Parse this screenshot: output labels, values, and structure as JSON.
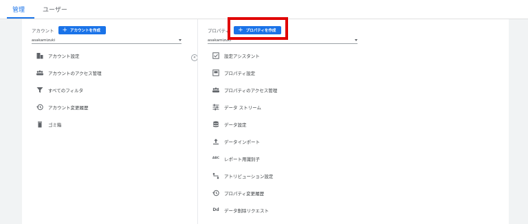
{
  "tabs": [
    {
      "label": "管理",
      "active": true
    },
    {
      "label": "ユーザー",
      "active": false
    }
  ],
  "account": {
    "label": "アカウント",
    "create_button": "アカウントを作成",
    "selected": "asakamizuki",
    "items": [
      {
        "label": "アカウント設定",
        "icon": "building-icon"
      },
      {
        "label": "アカウントのアクセス管理",
        "icon": "people-icon"
      },
      {
        "label": "すべてのフィルタ",
        "icon": "filter-icon"
      },
      {
        "label": "アカウント変更履歴",
        "icon": "history-icon"
      },
      {
        "label": "ゴミ箱",
        "icon": "trash-icon"
      }
    ]
  },
  "property": {
    "label": "プロパティ",
    "create_button": "プロパティを作成",
    "selected": "asakamizuki",
    "items": [
      {
        "label": "設定アシスタント",
        "icon": "checkbox-icon"
      },
      {
        "label": "プロパティ設定",
        "icon": "document-icon"
      },
      {
        "label": "プロパティのアクセス管理",
        "icon": "people-icon"
      },
      {
        "label": "データ ストリーム",
        "icon": "streams-icon"
      },
      {
        "label": "データ設定",
        "icon": "database-icon"
      },
      {
        "label": "データインポート",
        "icon": "upload-icon"
      },
      {
        "label": "レポート用識別子",
        "icon": "identifier-icon"
      },
      {
        "label": "アトリビューション設定",
        "icon": "attribution-icon"
      },
      {
        "label": "プロパティ変更履歴",
        "icon": "history-icon"
      },
      {
        "label": "データ削除リクエスト",
        "icon": "dd-icon"
      }
    ]
  },
  "icon_text": {
    "identifier": "ABC",
    "dd": "Dd",
    "collapse": "«"
  },
  "colors": {
    "accent": "#1a73e8",
    "highlight": "#e00000"
  }
}
